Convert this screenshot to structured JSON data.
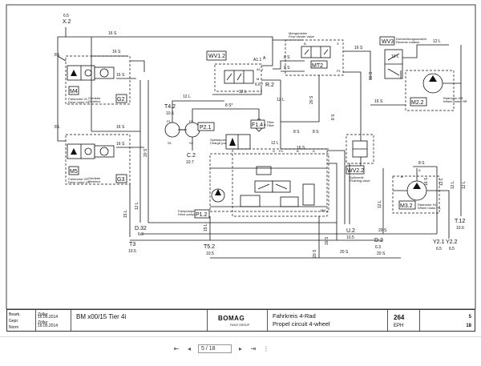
{
  "sheet": {
    "top_port": {
      "name": "X.2",
      "size": "6.5"
    },
    "motors": [
      {
        "tag": "M4",
        "desc_de": "Fahrmotor VL",
        "desc_en": "Drive motor VL",
        "gear_tag": "G2",
        "gear_de": "Getriebe",
        "gear_en": "Gearbox"
      },
      {
        "tag": "M5",
        "desc_de": "Fahrmotor VR",
        "desc_en": "Drive motor VR",
        "gear_tag": "G3",
        "gear_de": "Getriebe",
        "gear_en": "Gearbox"
      }
    ],
    "valves": {
      "wv1_2": "WV1.2",
      "mt2": "MT2",
      "mt2_desc_de": "Mengenteiler",
      "mt2_desc_en": "Flow divider valve",
      "wv3": "WV3",
      "wv3_desc_de": "Drehrichtungsumkehr",
      "wv3_desc_en": "Reverse rotation",
      "wv2_2": "WV2.2",
      "wv2_2_desc_de": "Spülventil",
      "wv2_2_desc_en": "Flushing valve"
    },
    "pumps": {
      "p2_1": "P2.1",
      "p1_2": "P1.2",
      "p1_2_desc_de": "Fahrpumpe",
      "p1_2_desc_en": "Drive pump",
      "charge_de": "Speisepumpe",
      "charge_en": "Charge pump",
      "filter": "F1.4",
      "filter_desc_de": "Filter",
      "filter_desc_en": "Filter"
    },
    "wheel_motors": [
      {
        "tag": "M2.2",
        "desc_de": "Radmotor HR",
        "desc_en": "Wheel motor HR"
      },
      {
        "tag": "M3.2",
        "desc_de": "Radmotor HL",
        "desc_en": "Wheel motor HL"
      }
    ],
    "ports": [
      {
        "name": "T4.2",
        "size": "10.5"
      },
      {
        "name": "C.2",
        "size": "10.7"
      },
      {
        "name": "R.2",
        "size": "6.6 /"
      },
      {
        "name": "D.32",
        "size": "6.3"
      },
      {
        "name": "T3",
        "size": "10.5"
      },
      {
        "name": "T5.2",
        "size": "10.5"
      },
      {
        "name": "U.2",
        "size": "10.5"
      },
      {
        "name": "D.2",
        "size": "6.3"
      },
      {
        "name": "Y2.1",
        "size": "6.5"
      },
      {
        "name": "Y2.2",
        "size": "6.5"
      },
      {
        "name": "T.12",
        "size": "10.6"
      }
    ],
    "line_labels": {
      "h16s_top": "16 S",
      "h16s_motor_top": "16 S",
      "h16s_motor_bot": "16 S",
      "h16s_mid": "16 S",
      "h16s_lower": "16 S",
      "h16s_wv2": "16 S",
      "h12l_a": "12 L",
      "h12l_b": "12 L",
      "h12l_c": "12 L",
      "h12l_d": "12 L",
      "h12l_e": "12 L",
      "h8s_a": "8 S",
      "h8s_b": "8 S",
      "h8s_c": "8 S",
      "h8s_d": "8 S",
      "h8s_e": "8 S",
      "h8l_a": "8 L",
      "h8l_b": "8 L",
      "h10l": "10 L",
      "h20s_a": "20 S",
      "h20s_b": "20 S",
      "h20s_c": "20 S",
      "v20s_a": "20 S",
      "v20s_b": "20 S",
      "v20s_c": "20 S",
      "v15l": "15 L",
      "v12l": "12 L",
      "v16s_a": "16 S",
      "v16s_b": "16 S",
      "v16s_c": "16 S",
      "v12l_b": "12 L",
      "v12l_c": "12 L",
      "v12l_d": "12 L",
      "v12l_e": "12 L",
      "v8s": "8 S",
      "v15l_b": "15 L",
      "v8s_star": "8 S*"
    },
    "pin_letters": [
      "A",
      "B",
      "P",
      "T",
      "L",
      "X",
      "M",
      "S",
      "P1",
      "P2"
    ]
  },
  "titleblock": {
    "left_rows": [
      "Bearb.",
      "Gepr.",
      "Norm"
    ],
    "left_names": [
      "Zöller",
      "Zöller"
    ],
    "left_dates": [
      "16.05.2014",
      "16.05.2014"
    ],
    "model": "BM x00/15 Tier 4i",
    "brand": "BOMAG",
    "brand_sub": "FAYAT GROUP",
    "title_de": "Fahrkreis 4-Rad",
    "title_en": "Propel circuit 4-wheel",
    "page_no": "264",
    "eph": "EPH",
    "sheet": "5",
    "sheets": "18",
    "col_numbers": [
      "1",
      "2",
      "3",
      "4",
      "5",
      "6",
      "7",
      "8",
      "9",
      "10"
    ]
  },
  "viewer": {
    "page_display": "5 / 18",
    "first_icon": "first-page-icon",
    "prev_icon": "prev-page-icon",
    "next_icon": "next-page-icon",
    "last_icon": "last-page-icon",
    "more_icon": "more-pages-icon"
  }
}
